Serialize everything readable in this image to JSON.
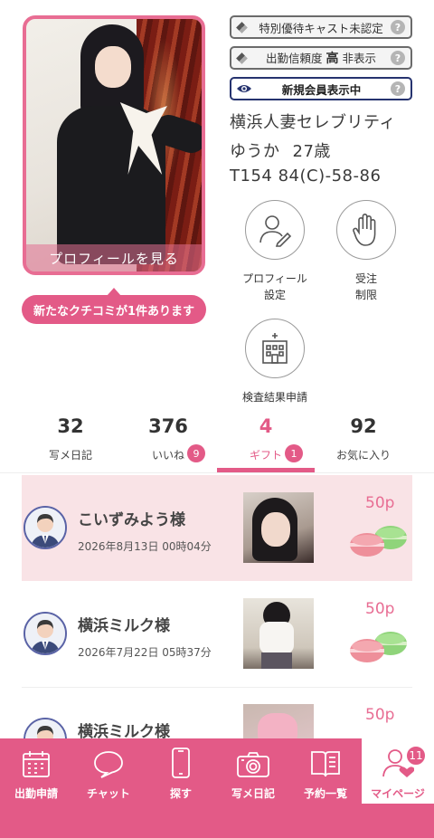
{
  "profile": {
    "view_label": "プロフィールを見る",
    "review_notice": "新たなクチコミが1件あります"
  },
  "status": {
    "special_cast": "特別優待キャスト未認定",
    "attendance_prefix": "出勤信頼度",
    "attendance_level": "高",
    "attendance_suffix": "非表示",
    "new_member": "新規会員表示中",
    "help_mark": "?"
  },
  "cast": {
    "shop": "横浜人妻セレブリティ",
    "name": "ゆうか",
    "age": "27歳",
    "size": "T154 84(C)-58-86"
  },
  "actions": [
    {
      "label": "プロフィール\n設定",
      "icon": "profile-edit-icon"
    },
    {
      "label": "受注\n制限",
      "icon": "hand-stop-icon"
    },
    {
      "label": "検査結果申請",
      "icon": "hospital-icon"
    }
  ],
  "stats": [
    {
      "count": "32",
      "label": "写メ日記",
      "badge": ""
    },
    {
      "count": "376",
      "label": "いいね",
      "badge": "9"
    },
    {
      "count": "4",
      "label": "ギフト",
      "badge": "1"
    },
    {
      "count": "92",
      "label": "お気に入り",
      "badge": ""
    }
  ],
  "gifts": [
    {
      "sender": "こいずみよう様",
      "time": "2026年8月13日 00時04分",
      "points": "50p"
    },
    {
      "sender": "横浜ミルク様",
      "time": "2026年7月22日 05時37分",
      "points": "50p"
    },
    {
      "sender": "横浜ミルク様",
      "time": "",
      "points": "50p"
    }
  ],
  "nav": [
    {
      "label": "出勤申請",
      "icon": "calendar-icon"
    },
    {
      "label": "チャット",
      "icon": "chat-bubble-icon"
    },
    {
      "label": "探す",
      "icon": "smartphone-icon"
    },
    {
      "label": "写メ日記",
      "icon": "camera-icon"
    },
    {
      "label": "予約一覧",
      "icon": "book-icon"
    },
    {
      "label": "マイページ",
      "icon": "user-heart-icon",
      "badge": "11"
    }
  ],
  "colors": {
    "accent": "#e35a87",
    "highlight_row": "#f9e3e6",
    "border_blue": "#26336f"
  }
}
